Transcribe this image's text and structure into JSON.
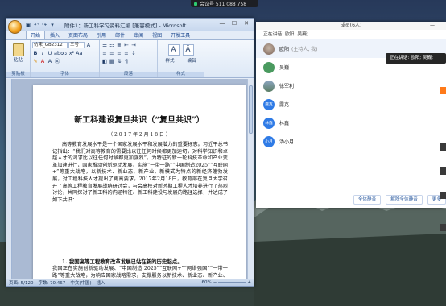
{
  "meeting_bar": {
    "label": "会议号 511 088 758"
  },
  "word": {
    "title": "附件1：新工科学习资料汇编 [兼容模式] - Microsoft...",
    "tabs": [
      "开始",
      "插入",
      "页面布局",
      "引用",
      "邮件",
      "审阅",
      "视图",
      "开发工具"
    ],
    "active_tab": "开始",
    "ribbon": {
      "paste_label": "粘贴",
      "font_name": "仿宋_GB2312",
      "font_size": "三号",
      "styles_label": "样式",
      "edit_label": "编辑",
      "group_clipboard": "剪贴板",
      "group_font": "字体",
      "group_paragraph": "段落",
      "group_styles": "样式"
    },
    "document": {
      "title": "新工科建设复旦共识（“复旦共识”）",
      "date": "（ 2 0 1 7 年 2 月 1 8 日 ）",
      "para1": "高等教育发展水平是一个国家发展水平和发展潜力的重要标志。习近平总书记指出：“我们对高等教育的需要比以往任何时候都更加迫切，对科学知识和卓越人才的渴求比以往任何时候都更加强烈”。为特征的新一轮科技革命和产业变革加速进行，国家推动创新驱动发展，实施“一带一路”“中国制造2025”“互联网+”等重大战略，以新技术、新业态、新产业、新模式为特点的新经济蓬勃发展，对工程科技人才提出了更高要求。2017年2月18日，教育部在复旦大学召开了高等工程教育发展战略研讨会，与会高校对新时期工程人才培养进行了热烈讨论，共同探讨了新工科的内涵特征、新工科建设与发展的路径选择，并达成了如下共识：",
      "heading2": "1. 我国高等工程教育改革发展已站在新的历史起点。",
      "para2": "我国正在实施创新驱动发展、“中国制造 2025”“互联网+”“网络强国”“一带一路”等重大战略，为响应国家战略需求，支撑服务以新技术、新业态、新产业、新模式为特点的新经济蓬勃发展，突破核心关键技术，构筑先发优势，在未来全球创新生态系统中占据战略制高点，迫切需要培养大批"
    },
    "status": {
      "page": "页面: 5/120",
      "words": "字数: 70,467",
      "lang": "中文(中国)",
      "mode": "插入",
      "zoom": "60%"
    }
  },
  "participants": {
    "header": "成员(6人)",
    "speaking": "正在讲话: 欧阳; 吴巍;",
    "list": [
      {
        "name": "欧阳",
        "sub": "(主持人, 我)",
        "avatar": "photo"
      },
      {
        "name": "吴巍",
        "sub": "",
        "avatar": "green"
      },
      {
        "name": "徐军利",
        "sub": "",
        "avatar": "lake"
      },
      {
        "name": "露克",
        "sub": "",
        "avatar": "blue",
        "initials": "露克"
      },
      {
        "name": "林鑫",
        "sub": "",
        "avatar": "blue",
        "initials": "林鑫"
      },
      {
        "name": "汤小月",
        "sub": "",
        "avatar": "blue",
        "initials": "小月"
      }
    ],
    "buttons": [
      "全体静音",
      "解除全体静音",
      "更多"
    ]
  },
  "tooltip": {
    "text": "正在讲话: 欧阳; 吴巍;"
  },
  "colors": {
    "accent": "#2f7be6",
    "word_frame": "#7f95b8",
    "dock_orange": "#ff7a19"
  }
}
